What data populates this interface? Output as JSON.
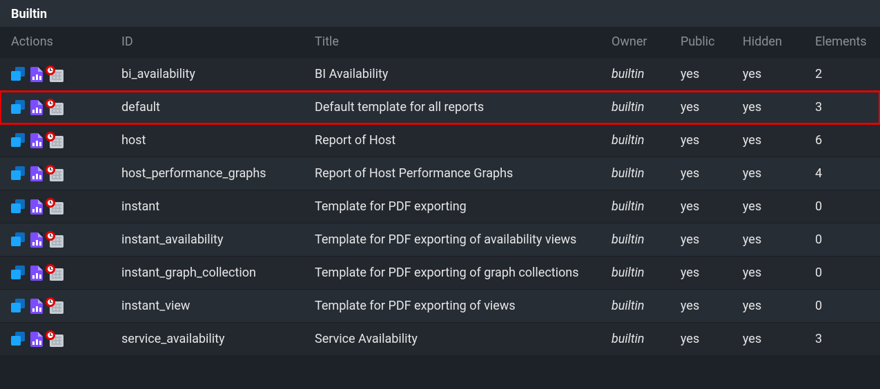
{
  "section_title": "Builtin",
  "columns": {
    "actions": "Actions",
    "id": "ID",
    "title": "Title",
    "owner": "Owner",
    "public": "Public",
    "hidden": "Hidden",
    "elements": "Elements"
  },
  "icons": {
    "clone": "clone-icon",
    "report": "report-icon",
    "schedule": "schedule-icon"
  },
  "highlighted_row_index": 1,
  "rows": [
    {
      "id": "bi_availability",
      "title": "BI Availability",
      "owner": "builtin",
      "public": "yes",
      "hidden": "yes",
      "elements": "2"
    },
    {
      "id": "default",
      "title": "Default template for all reports",
      "owner": "builtin",
      "public": "yes",
      "hidden": "yes",
      "elements": "3"
    },
    {
      "id": "host",
      "title": "Report of Host",
      "owner": "builtin",
      "public": "yes",
      "hidden": "yes",
      "elements": "6"
    },
    {
      "id": "host_performance_graphs",
      "title": "Report of Host Performance Graphs",
      "owner": "builtin",
      "public": "yes",
      "hidden": "yes",
      "elements": "4"
    },
    {
      "id": "instant",
      "title": "Template for PDF exporting",
      "owner": "builtin",
      "public": "yes",
      "hidden": "yes",
      "elements": "0"
    },
    {
      "id": "instant_availability",
      "title": "Template for PDF exporting of availability views",
      "owner": "builtin",
      "public": "yes",
      "hidden": "yes",
      "elements": "0"
    },
    {
      "id": "instant_graph_collection",
      "title": "Template for PDF exporting of graph collections",
      "owner": "builtin",
      "public": "yes",
      "hidden": "yes",
      "elements": "0"
    },
    {
      "id": "instant_view",
      "title": "Template for PDF exporting of views",
      "owner": "builtin",
      "public": "yes",
      "hidden": "yes",
      "elements": "0"
    },
    {
      "id": "service_availability",
      "title": "Service Availability",
      "owner": "builtin",
      "public": "yes",
      "hidden": "yes",
      "elements": "3"
    }
  ]
}
